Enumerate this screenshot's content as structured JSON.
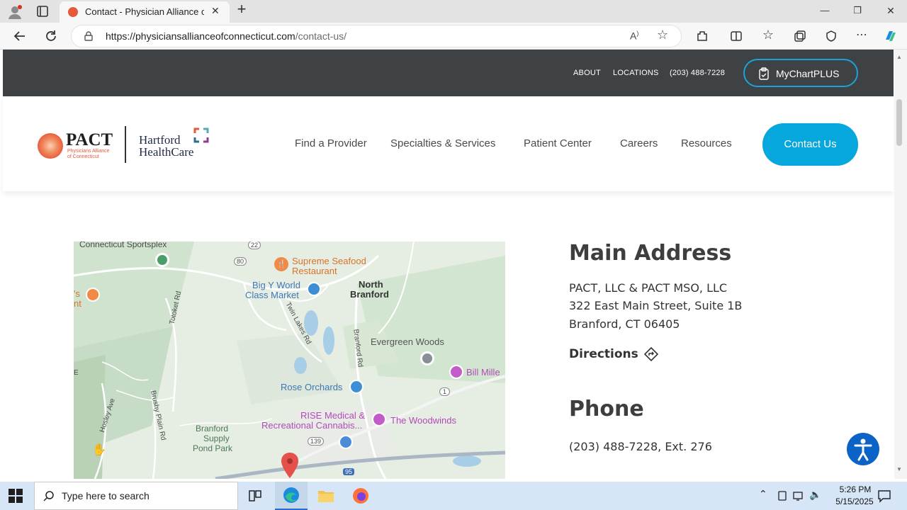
{
  "browser": {
    "tab_title": "Contact - Physician Alliance of C",
    "url_host": "https://physiciansallianceofconnecticut.com",
    "url_path": "/contact-us/",
    "new_tab": "+",
    "window_min": "—",
    "window_max": "❐",
    "window_close": "✕"
  },
  "site": {
    "toplinks": {
      "about": "ABOUT",
      "locations": "LOCATIONS",
      "phone": "(203) 488-7228"
    },
    "mychart_label": "MyChartPLUS",
    "logo": {
      "pact": "PACT",
      "pact_sub1": "Physicians Alliance",
      "pact_sub2": "of Connecticut",
      "hh1": "Hartford",
      "hh2": "HealthCare"
    },
    "nav": [
      "Find a Provider",
      "Specialties & Services",
      "Patient Center",
      "Careers",
      "Resources"
    ],
    "contact_label": "Contact Us",
    "main_address_heading": "Main Address",
    "address_lines": [
      "PACT, LLC & PACT MSO, LLC",
      "322 East Main Street, Suite 1B",
      "Branford, CT 06405"
    ],
    "directions_label": "Directions",
    "phone_heading": "Phone",
    "phone_value": "(203) 488-7228, Ext. 276"
  },
  "map": {
    "labels": {
      "sportsplex": "Connecticut Sportsplex",
      "seafood1": "Supreme Seafood",
      "seafood2": "Restaurant",
      "bigy1": "Big Y World",
      "bigy2": "Class Market",
      "north1": "North",
      "north2": "Branford",
      "evergreen": "Evergreen Woods",
      "billmille": "Bill Mille",
      "rose": "Rose Orchards",
      "rise1": "RISE Medical &",
      "rise2": "Recreational Cannabis...",
      "woodwinds": "The Woodwinds",
      "pond1": "Branford",
      "pond2": "Supply",
      "pond3": "Pond Park",
      "totoket": "Totoket Rd",
      "twinlakes": "Twin Lakes Rd",
      "branfordrd": "Branford Rd",
      "brushy": "Brushy Plain Rd",
      "hosley": "Hosley Ave",
      "r22": "22",
      "r80": "80",
      "r139": "139",
      "r1": "1",
      "r95": "95",
      "edge_s": "'s",
      "edge_t": "nt",
      "edge_e": "E"
    }
  },
  "taskbar": {
    "search_placeholder": "Type here to search",
    "time": "5:26 PM",
    "date": "5/15/2025"
  },
  "colors": {
    "accent": "#05a7dd",
    "topbar": "#3f4244",
    "pact_orange": "#e8573a"
  }
}
